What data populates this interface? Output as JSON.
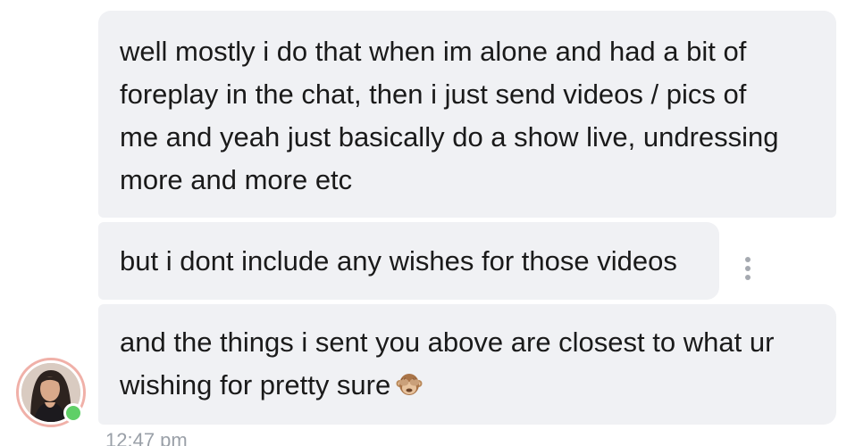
{
  "messages": [
    {
      "text": "well mostly i do that when im alone and had a bit of\nforeplay in the chat, then i just send videos / pics of\nme and yeah just basically do a show live, undressing\nmore and more etc"
    },
    {
      "text": "but i dont include any wishes for those videos"
    },
    {
      "text": "and the things i sent you above are closest to what ur\nwishing for pretty sure"
    }
  ],
  "emoji": {
    "name": "see-no-evil-monkey-icon"
  },
  "more_menu": {
    "icon": "more-vertical-icon"
  },
  "sender": {
    "status": "online",
    "status_color": "#5fcf67"
  },
  "timestamp": "12:47 pm"
}
